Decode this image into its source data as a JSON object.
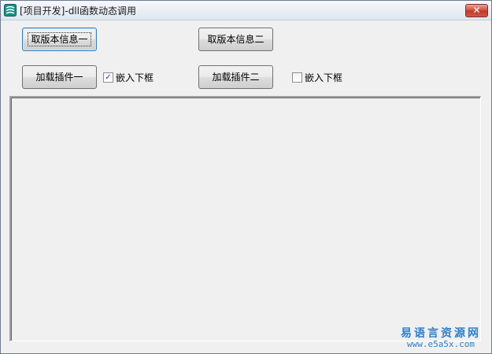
{
  "window": {
    "title": "[项目开发]-dll函数动态调用",
    "close_label": "✕"
  },
  "buttons": {
    "get_version_1": "取版本信息一",
    "get_version_2": "取版本信息二",
    "load_plugin_1": "加载插件一",
    "load_plugin_2": "加载插件二"
  },
  "checkboxes": {
    "embed_frame_1": {
      "label": "嵌入下框",
      "checked": true
    },
    "embed_frame_2": {
      "label": "嵌入下框",
      "checked": false
    }
  },
  "watermark": {
    "cn": "易语言资源网",
    "url": "www.e5a5x.com"
  },
  "colors": {
    "watermark": "#2f7fc7",
    "close_button": "#c0392b"
  }
}
